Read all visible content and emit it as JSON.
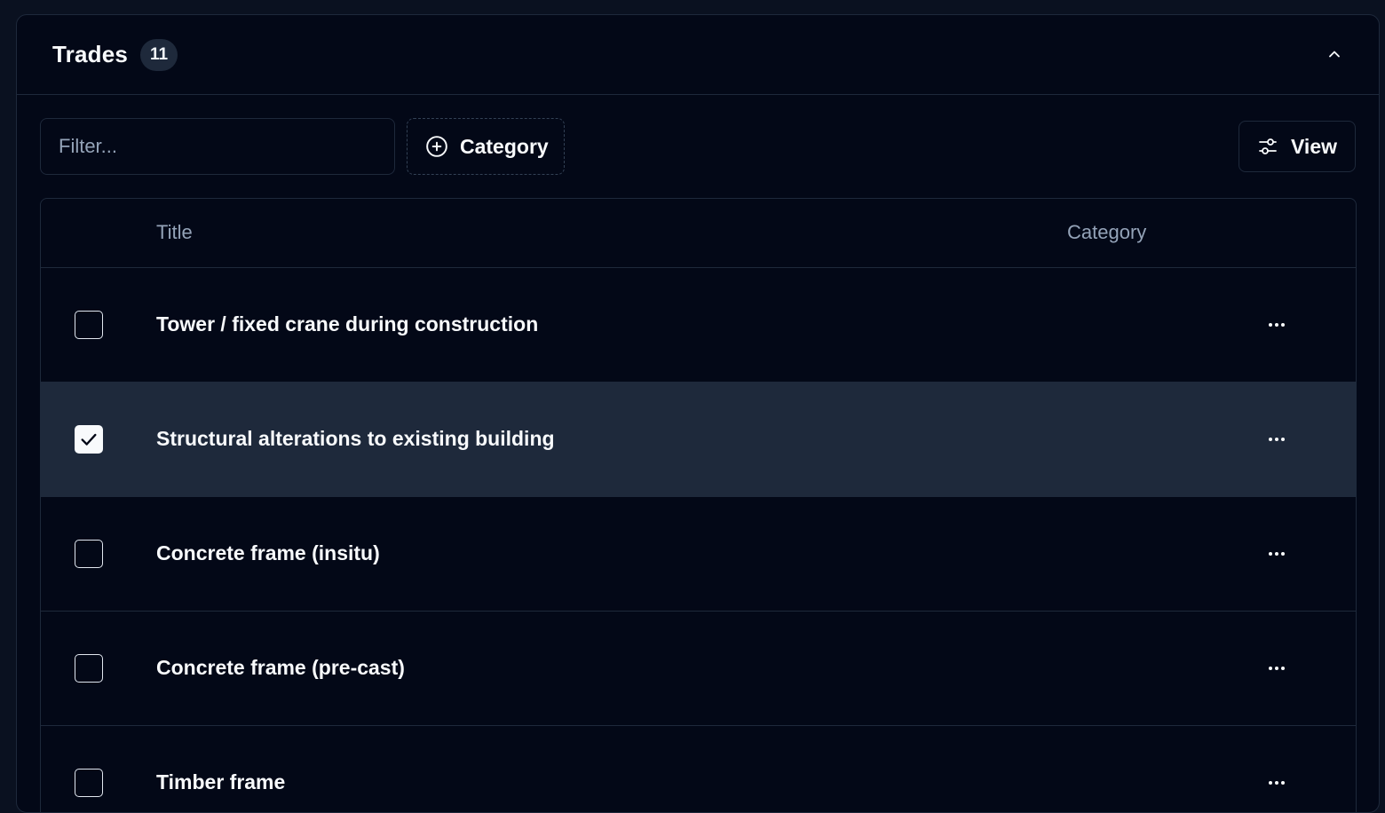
{
  "card": {
    "title": "Trades",
    "count": "11"
  },
  "toolbar": {
    "filter_placeholder": "Filter...",
    "filter_value": "",
    "category_label": "Category",
    "view_label": "View"
  },
  "table": {
    "columns": [
      "Title",
      "Category"
    ],
    "rows": [
      {
        "title": "Tower / fixed crane during construction",
        "category": "",
        "checked": false
      },
      {
        "title": "Structural alterations to existing building",
        "category": "",
        "checked": true
      },
      {
        "title": "Concrete frame (insitu)",
        "category": "",
        "checked": false
      },
      {
        "title": "Concrete frame (pre-cast)",
        "category": "",
        "checked": false
      },
      {
        "title": "Timber frame",
        "category": "",
        "checked": false
      }
    ]
  },
  "icons": {
    "collapse": "chevron-up-icon",
    "category": "plus-circle-icon",
    "view": "sliders-icon",
    "row_menu": "more-horizontal-icon",
    "check": "check-icon"
  },
  "colors": {
    "background": "#030817",
    "border": "#1e293b",
    "selected_row": "#1e293b",
    "text": "#f8fafc",
    "muted": "#94a3b8"
  }
}
